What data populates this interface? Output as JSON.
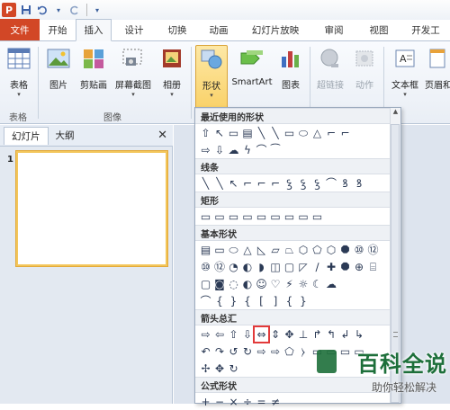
{
  "qat": {
    "logo": "P",
    "icons": [
      "save-icon",
      "undo-icon",
      "redo-icon",
      "customize-icon"
    ]
  },
  "tabs": [
    "文件",
    "开始",
    "插入",
    "设计",
    "切换",
    "动画",
    "幻灯片放映",
    "审阅",
    "视图",
    "开发工"
  ],
  "active_tab": "插入",
  "ribbon": {
    "table_label": "表格",
    "picture_label": "图片",
    "clipart_label": "剪贴画",
    "screenshot_label": "屏幕截图",
    "album_label": "相册",
    "shapes_label": "形状",
    "smartart_label": "SmartArt",
    "chart_label": "图表",
    "hyperlink_label": "超链接",
    "action_label": "动作",
    "textbox_label": "文本框",
    "headerfooter_label": "页眉和",
    "group_tables": "表格",
    "group_images": "图像"
  },
  "pane": {
    "tab_slides": "幻灯片",
    "tab_outline": "大纲",
    "slide_number": "1"
  },
  "gallery": {
    "sections": [
      {
        "title": "最近使用的形状"
      },
      {
        "title": "线条"
      },
      {
        "title": "矩形"
      },
      {
        "title": "基本形状"
      },
      {
        "title": "箭头总汇"
      },
      {
        "title": "公式形状"
      }
    ],
    "recent_row1": [
      "⇧",
      "↖",
      "▭",
      "▤",
      "╲",
      "╲",
      "▭",
      "⬭",
      "△",
      "⌐",
      "⌐"
    ],
    "recent_row2": [
      "⇨",
      "⇩",
      "☁",
      "ϟ",
      "⌒",
      "⁀"
    ],
    "lines_row": [
      "╲",
      "╲",
      "↖",
      "⌐",
      "⌐",
      "⌐",
      "ꝣ",
      "ꝣ",
      "ꝣ",
      "⌒",
      "ꝸ",
      "ꝸ"
    ],
    "rect_row": [
      "▭",
      "▭",
      "▭",
      "▭",
      "▭",
      "▭",
      "▭",
      "▭",
      "▭"
    ],
    "basic_row1": [
      "▤",
      "▭",
      "⬭",
      "△",
      "◺",
      "▱",
      "⏢",
      "⬡",
      "⬠",
      "⬡",
      "⯃",
      "⑩",
      "⑫"
    ],
    "basic_row2": [
      "⑩",
      "⑫",
      "◔",
      "◐",
      "◗",
      "◫",
      "▢",
      "◸",
      "∕",
      "✚",
      "⯃",
      "⊕",
      "⌸"
    ],
    "basic_row3": [
      "▢",
      "◙",
      "◌",
      "◐",
      "☺",
      "♡",
      "⚡",
      "☼",
      "☾",
      "☁"
    ],
    "basic_row4": [
      "⌒",
      "{",
      "}",
      "{",
      "[",
      "]",
      "{",
      "}"
    ],
    "arrows_row1": [
      "⇨",
      "⇦",
      "⇧",
      "⇩",
      "⇔",
      "⇕",
      "✥",
      "⊥",
      "↱",
      "↰",
      "↲",
      "↳"
    ],
    "arrows_row2": [
      "↶",
      "↷",
      "↺",
      "↻",
      "⇨",
      "⇨",
      "⬠",
      "⧽",
      "▭",
      "▭",
      "▭",
      "▭"
    ],
    "arrows_row3": [
      "✢",
      "✥",
      "↻"
    ],
    "math_row": [
      "+",
      "−",
      "×",
      "÷",
      "=",
      "≠"
    ],
    "selected_shape": "⇔"
  },
  "watermark": {
    "title": "百科全说",
    "subtitle": "助你轻松解决"
  },
  "colors": {
    "file_tab": "#d24726",
    "highlight": "#e23a3a",
    "ribbon_active": "#f9cf61"
  }
}
